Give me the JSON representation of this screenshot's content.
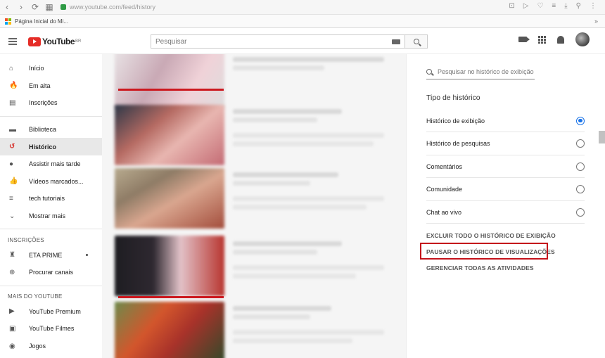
{
  "browser": {
    "url": "www.youtube.com/feed/history",
    "bookmark": "Página Inicial do Mi..."
  },
  "header": {
    "logo_text": "YouTube",
    "logo_sup": "BR",
    "search_placeholder": "Pesquisar"
  },
  "sidebar": {
    "main": [
      {
        "label": "Início",
        "icon": "home-icon"
      },
      {
        "label": "Em alta",
        "icon": "trending-icon"
      },
      {
        "label": "Inscrições",
        "icon": "subscriptions-icon"
      }
    ],
    "library": [
      {
        "label": "Biblioteca",
        "icon": "library-icon"
      },
      {
        "label": "Histórico",
        "icon": "history-icon",
        "active": true
      },
      {
        "label": "Assistir mais tarde",
        "icon": "watch-later-icon"
      },
      {
        "label": "Vídeos marcados...",
        "icon": "liked-videos-icon"
      },
      {
        "label": "tech tutoriais",
        "icon": "playlist-icon"
      },
      {
        "label": "Mostrar mais",
        "icon": "chevron-down-icon"
      }
    ],
    "subs_title": "INSCRIÇÕES",
    "subs": [
      {
        "label": "ETA PRIME",
        "icon": "channel-avatar-icon"
      },
      {
        "label": "Procurar canais",
        "icon": "add-circle-icon"
      }
    ],
    "more_title": "MAIS DO YOUTUBE",
    "more": [
      {
        "label": "YouTube Premium",
        "icon": "youtube-premium-icon"
      },
      {
        "label": "YouTube Filmes",
        "icon": "youtube-movies-icon"
      },
      {
        "label": "Jogos",
        "icon": "gaming-icon"
      }
    ]
  },
  "panel": {
    "search_placeholder": "Pesquisar no histórico de exibição",
    "type_title": "Tipo de histórico",
    "options": [
      {
        "label": "Histórico de exibição",
        "checked": true
      },
      {
        "label": "Histórico de pesquisas",
        "checked": false
      },
      {
        "label": "Comentários",
        "checked": false
      },
      {
        "label": "Comunidade",
        "checked": false
      },
      {
        "label": "Chat ao vivo",
        "checked": false
      }
    ],
    "actions": [
      "EXCLUIR TODO O HISTÓRICO DE EXIBIÇÃO",
      "PAUSAR O HISTÓRICO DE VISUALIZAÇÕES",
      "GERENCIAR TODAS AS ATIVIDADES"
    ]
  },
  "colors": {
    "accent": "#1a73e8",
    "youtube_red": "#e52d27",
    "highlight": "#c4121b"
  }
}
